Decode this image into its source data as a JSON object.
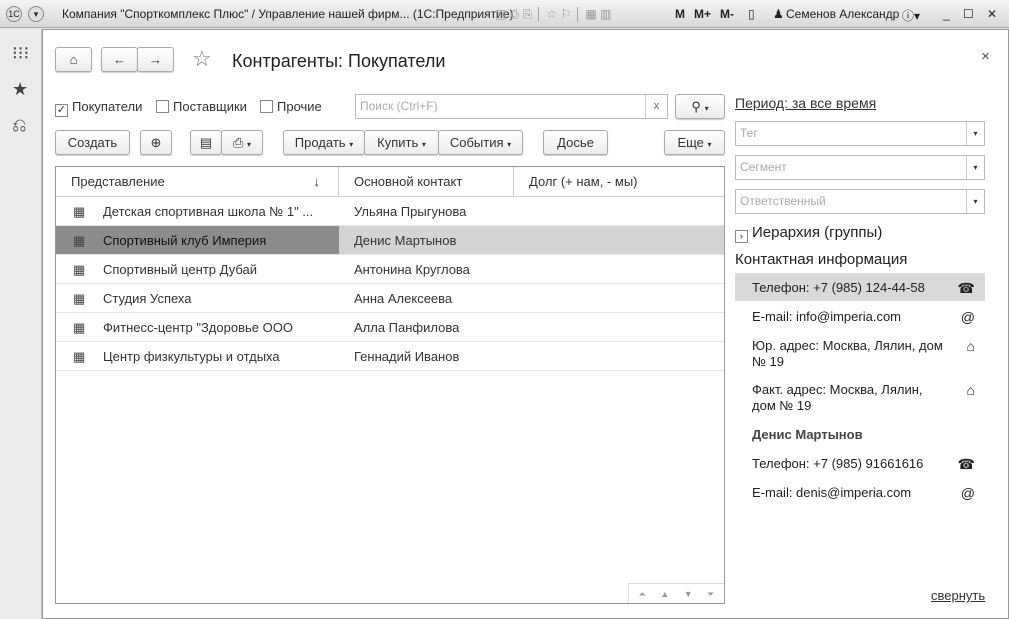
{
  "window": {
    "title": "Компания \"Спорткомплекс Плюс\" / Управление нашей фирм...  (1С:Предприятие)",
    "user": "Семенов Александр",
    "m": "M",
    "mplus": "M+",
    "mminus": "M-"
  },
  "page": {
    "title": "Контрагенты: Покупатели",
    "close": "×"
  },
  "filters": [
    {
      "label": "Покупатели",
      "checked": true
    },
    {
      "label": "Поставщики",
      "checked": false
    },
    {
      "label": "Прочие",
      "checked": false
    }
  ],
  "search": {
    "placeholder": "Поиск (Ctrl+F)",
    "clear": "x"
  },
  "toolbar": {
    "create": "Создать",
    "sell": "Продать",
    "buy": "Купить",
    "events": "События",
    "dossier": "Досье",
    "more": "Еще"
  },
  "table": {
    "columns": [
      "Представление",
      "Основной контакт",
      "Долг (+ нам, - мы)"
    ],
    "sort_arrow": "↓",
    "rows": [
      {
        "name": "Детская спортивная школа  № 1\" ...",
        "contact": "Ульяна Прыгунова",
        "debt": ""
      },
      {
        "name": "Спортивный клуб Империя",
        "contact": "Денис Мартынов",
        "debt": "",
        "selected": true
      },
      {
        "name": "Спортивный центр Дубай",
        "contact": "Антонина Круглова",
        "debt": ""
      },
      {
        "name": "Студия Успеха",
        "contact": "Анна Алексеева",
        "debt": ""
      },
      {
        "name": "Фитнесс-центр \"Здоровье ООО",
        "contact": "Алла Панфилова",
        "debt": ""
      },
      {
        "name": "Центр физкультуры и отдыха",
        "contact": "Геннадий Иванов",
        "debt": ""
      }
    ]
  },
  "right": {
    "period": "Период: за все время",
    "tag": "Тег",
    "segment": "Сегмент",
    "responsible": "Ответственный",
    "hierarchy": "Иерархия (группы)",
    "contact_header": "Контактная информация",
    "contacts": [
      {
        "text": "Телефон: +7 (985) 124-44-58",
        "icon": "phone-icon"
      },
      {
        "text": "E-mail: info@imperia.com",
        "icon": "email-icon"
      },
      {
        "text": "Юр. адрес: Москва, Лялин, дом № 19",
        "icon": "home-icon"
      },
      {
        "text": "Факт. адрес: Москва, Лялин, дом № 19",
        "icon": "home-icon"
      }
    ],
    "person": "Денис Мартынов",
    "person_contacts": [
      {
        "text": "Телефон: +7 (985) 91661616",
        "icon": "phone-icon"
      },
      {
        "text": "E-mail: denis@imperia.com",
        "icon": "email-icon"
      }
    ],
    "collapse": "свернуть"
  }
}
